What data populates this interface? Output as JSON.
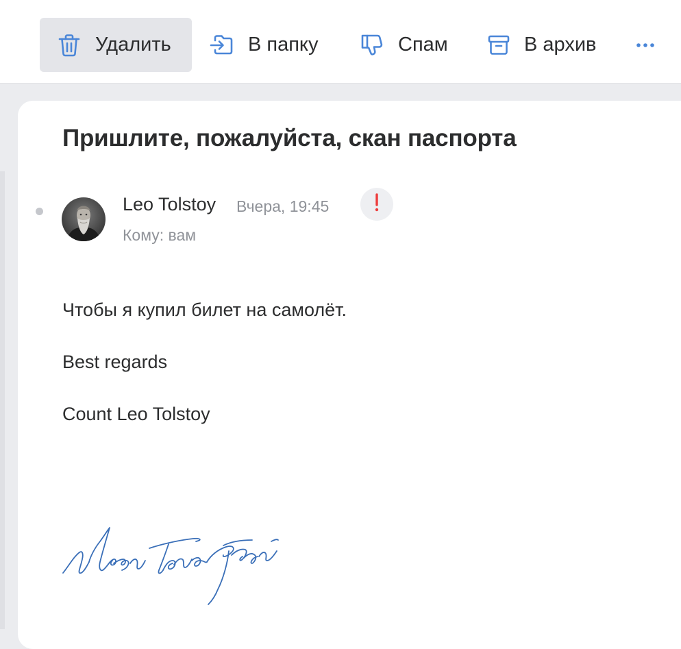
{
  "toolbar": {
    "delete": {
      "label": "Удалить",
      "icon": "trash-icon"
    },
    "move_to_folder": {
      "label": "В папку",
      "icon": "move-to-folder-icon"
    },
    "spam": {
      "label": "Спам",
      "icon": "thumbs-down-icon"
    },
    "archive": {
      "label": "В архив",
      "icon": "archive-box-icon"
    },
    "more": {
      "icon": "more-dots-icon"
    }
  },
  "message": {
    "subject": "Пришлите, пожалуйста, скан паспорта",
    "sender": "Leo Tolstoy",
    "date": "Вчера, 19:45",
    "to": "Кому: вам",
    "important_icon": "exclamation-icon",
    "body": [
      "Чтобы я купил билет на самолёт.",
      "Best regards",
      "Count Leo Tolstoy"
    ],
    "signature_text": "Лев Толстой"
  },
  "colors": {
    "accent": "#4a86d8",
    "important": "#ed3b3b",
    "signature": "#3a6fb8",
    "text": "#2c2d2e",
    "muted": "#909399"
  }
}
